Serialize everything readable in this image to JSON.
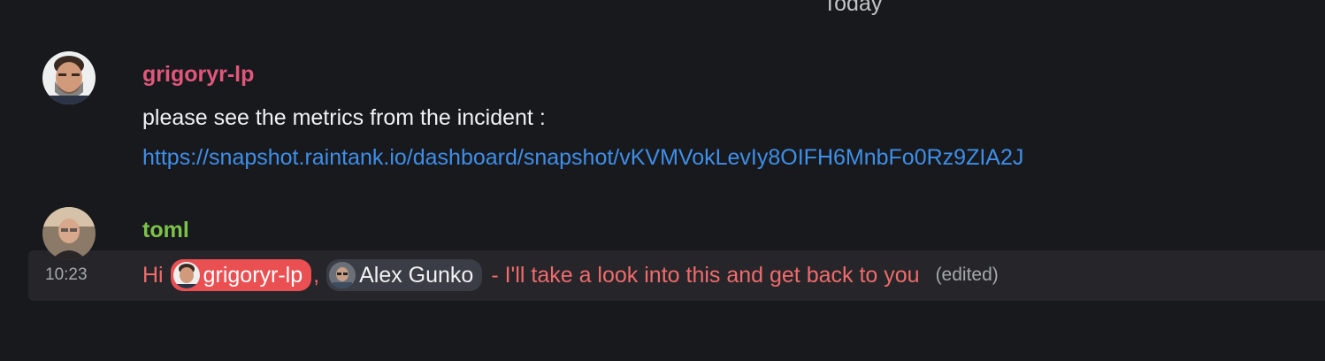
{
  "day_separator": "Today",
  "messages": [
    {
      "sender": "grigoryr-lp",
      "text": "please see the metrics from the incident :",
      "link": "https://snapshot.raintank.io/dashboard/snapshot/vKVMVokLevIy8OIFH6MnbFo0Rz9ZIA2J"
    },
    {
      "sender": "toml",
      "time": "10:23",
      "prefix": "Hi",
      "mention_self": "grigoryr-lp",
      "separator": ",",
      "mention_other": "Alex Gunko",
      "rest": "- I'll take a look into this and get back to you",
      "edited": "(edited)"
    }
  ],
  "colors": {
    "background": "#17191d",
    "sender_grigoryr": "#e0577a",
    "sender_toml": "#7cc24a",
    "link": "#3f8ee8",
    "highlight_text": "#f06b6b",
    "mention_self_bg": "#ea4f52",
    "mention_other_bg": "#3a3d45"
  }
}
